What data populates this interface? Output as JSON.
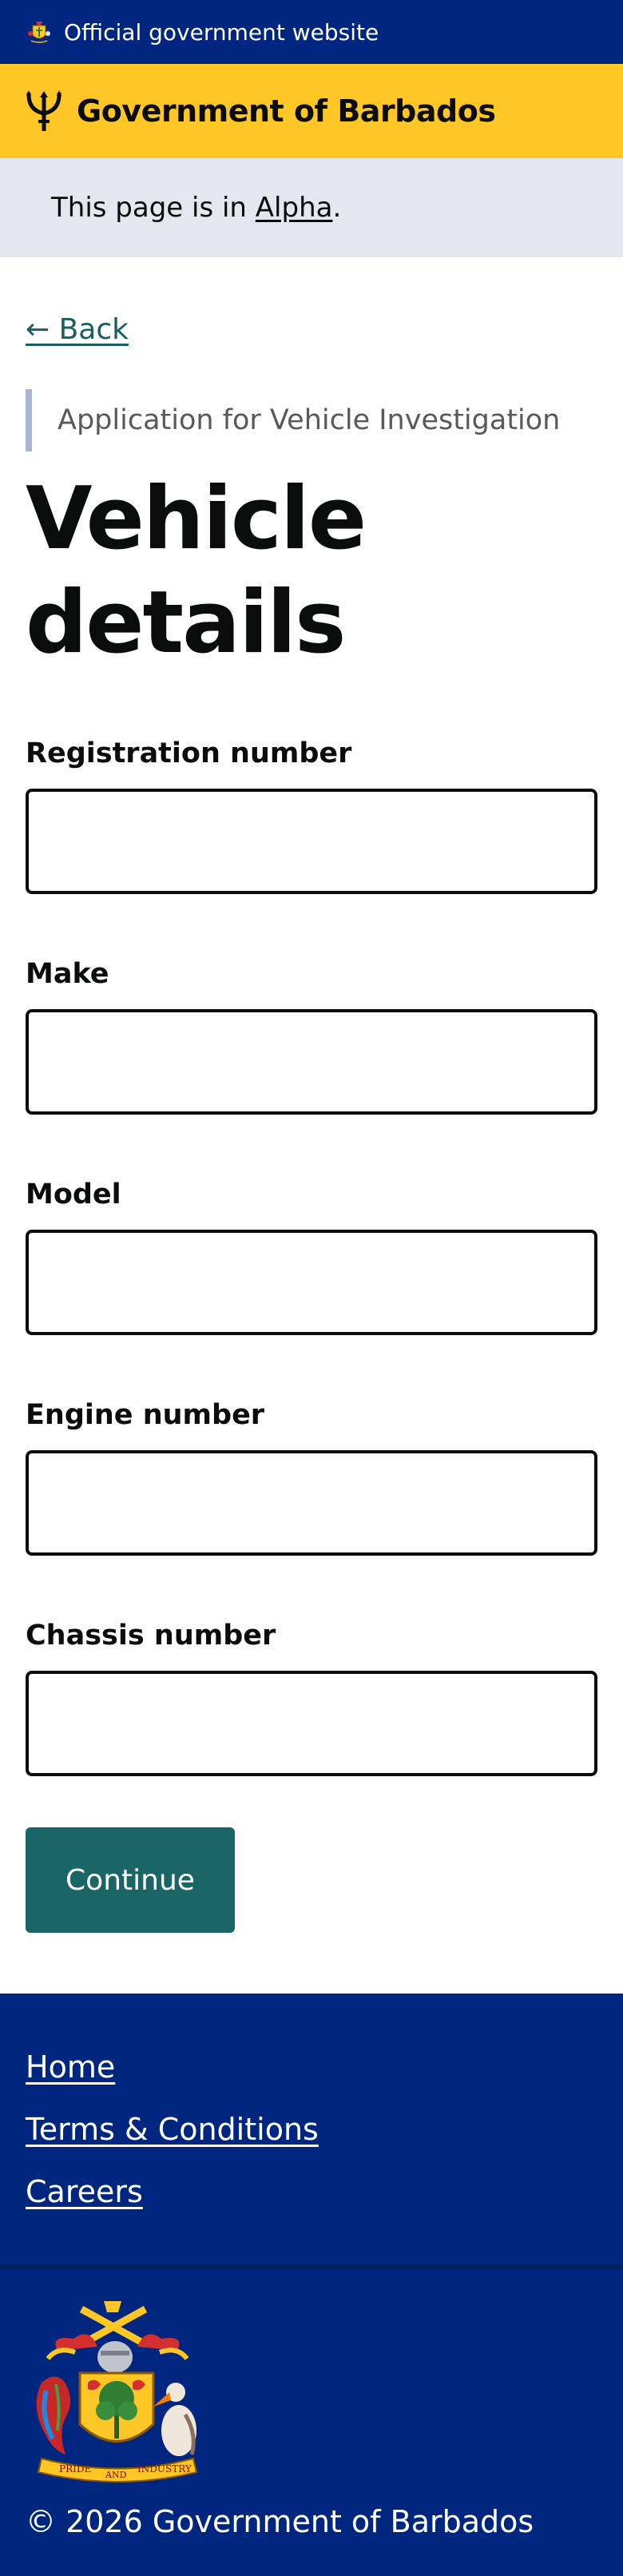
{
  "official_banner": {
    "text": "Official government website",
    "icon": "barbados-crest-icon"
  },
  "header": {
    "title": "Government of Barbados",
    "icon": "trident-icon"
  },
  "phase_banner": {
    "prefix": "This page is in ",
    "phase": "Alpha",
    "suffix": "."
  },
  "back_link": {
    "label": "← Back"
  },
  "page": {
    "caption": "Application for Vehicle Investigation",
    "title_line1": "Vehicle",
    "title_line2": "details"
  },
  "form": {
    "fields": [
      {
        "label": "Registration number",
        "value": ""
      },
      {
        "label": "Make",
        "value": ""
      },
      {
        "label": "Model",
        "value": ""
      },
      {
        "label": "Engine number",
        "value": ""
      },
      {
        "label": "Chassis number",
        "value": ""
      }
    ],
    "continue_label": "Continue"
  },
  "footer": {
    "links": [
      "Home",
      "Terms & Conditions",
      "Careers"
    ],
    "crest_motto_left": "PRIDE",
    "crest_motto_mid": "AND",
    "crest_motto_right": "INDUSTRY",
    "copyright": "© 2026 Government of Barbados"
  },
  "colors": {
    "banner_blue": "#00267f",
    "brand_yellow": "#ffc726",
    "phase_bg": "#e3e7ef",
    "button_teal": "#1a6666",
    "link_teal": "#1a5f5f"
  }
}
